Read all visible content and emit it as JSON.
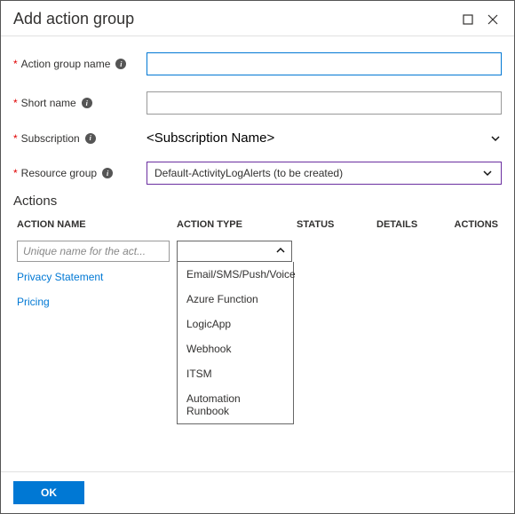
{
  "title": "Add action group",
  "fields": {
    "action_group_name": {
      "label": "Action group name",
      "value": ""
    },
    "short_name": {
      "label": "Short name",
      "value": ""
    },
    "subscription": {
      "label": "Subscription",
      "value": "<Subscription Name>"
    },
    "resource_group": {
      "label": "Resource group",
      "value": "Default-ActivityLogAlerts (to be created)"
    }
  },
  "actions_section": "Actions",
  "columns": {
    "name": "ACTION NAME",
    "type": "ACTION TYPE",
    "status": "STATUS",
    "details": "DETAILS",
    "actions": "ACTIONS"
  },
  "action_row": {
    "name_placeholder": "Unique name for the act..."
  },
  "type_options": [
    "Email/SMS/Push/Voice",
    "Azure Function",
    "LogicApp",
    "Webhook",
    "ITSM",
    "Automation Runbook"
  ],
  "links": {
    "privacy": "Privacy Statement",
    "pricing": "Pricing"
  },
  "ok": "OK"
}
